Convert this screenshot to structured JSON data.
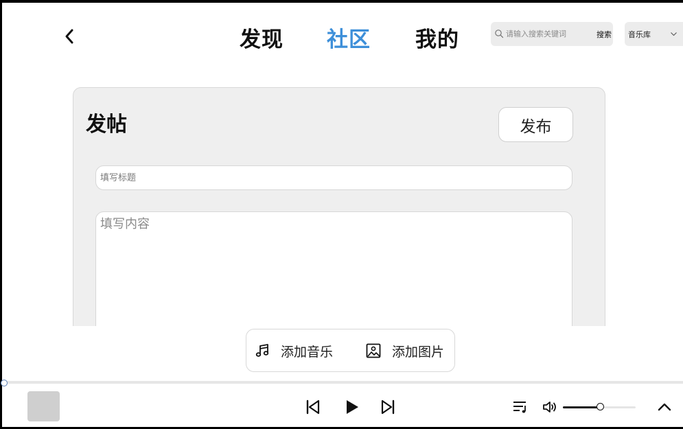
{
  "header": {
    "nav_tabs": [
      {
        "label": "发现",
        "active": false
      },
      {
        "label": "社区",
        "active": true
      },
      {
        "label": "我的",
        "active": false
      }
    ],
    "search": {
      "placeholder": "请输入搜索关键词",
      "button_label": "搜索"
    },
    "library_select": {
      "selected": "音乐库"
    }
  },
  "post_form": {
    "title": "发帖",
    "publish_label": "发布",
    "title_placeholder": "填写标题",
    "content_placeholder": "填写内容",
    "add_music_label": "添加音乐",
    "add_image_label": "添加图片"
  },
  "player": {
    "progress": 0,
    "volume": 0.5
  },
  "colors": {
    "active_tab": "#3d8fd9",
    "panel_bg": "#efefef",
    "field_bg": "#ffffff",
    "search_bg": "#ececec",
    "album_placeholder": "#cfcfcf"
  }
}
